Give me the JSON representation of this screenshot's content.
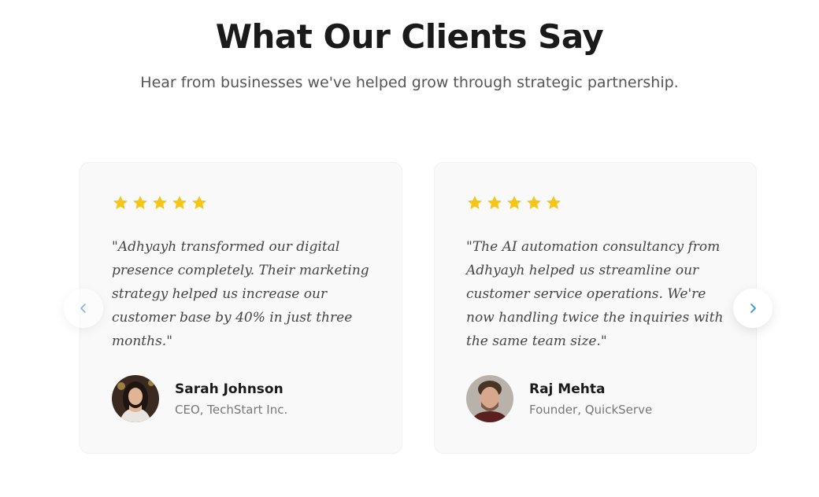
{
  "header": {
    "title": "What Our Clients Say",
    "subtitle": "Hear from businesses we've helped grow through strategic partnership."
  },
  "colors": {
    "star": "#F5C518",
    "nav_arrow": "#2B8FD6"
  },
  "carousel": {
    "prev_icon": "chevron-left-icon",
    "next_icon": "chevron-right-icon"
  },
  "testimonials": [
    {
      "rating": 5,
      "quote": "\"Adhyayh transformed our digital presence completely. Their marketing strategy helped us increase our customer base by 40% in just three months.\"",
      "name": "Sarah Johnson",
      "role": "CEO, TechStart Inc."
    },
    {
      "rating": 5,
      "quote": "\"The AI automation consultancy from Adhyayh helped us streamline our customer service operations. We're now handling twice the inquiries with the same team size.\"",
      "name": "Raj Mehta",
      "role": "Founder, QuickServe"
    }
  ]
}
